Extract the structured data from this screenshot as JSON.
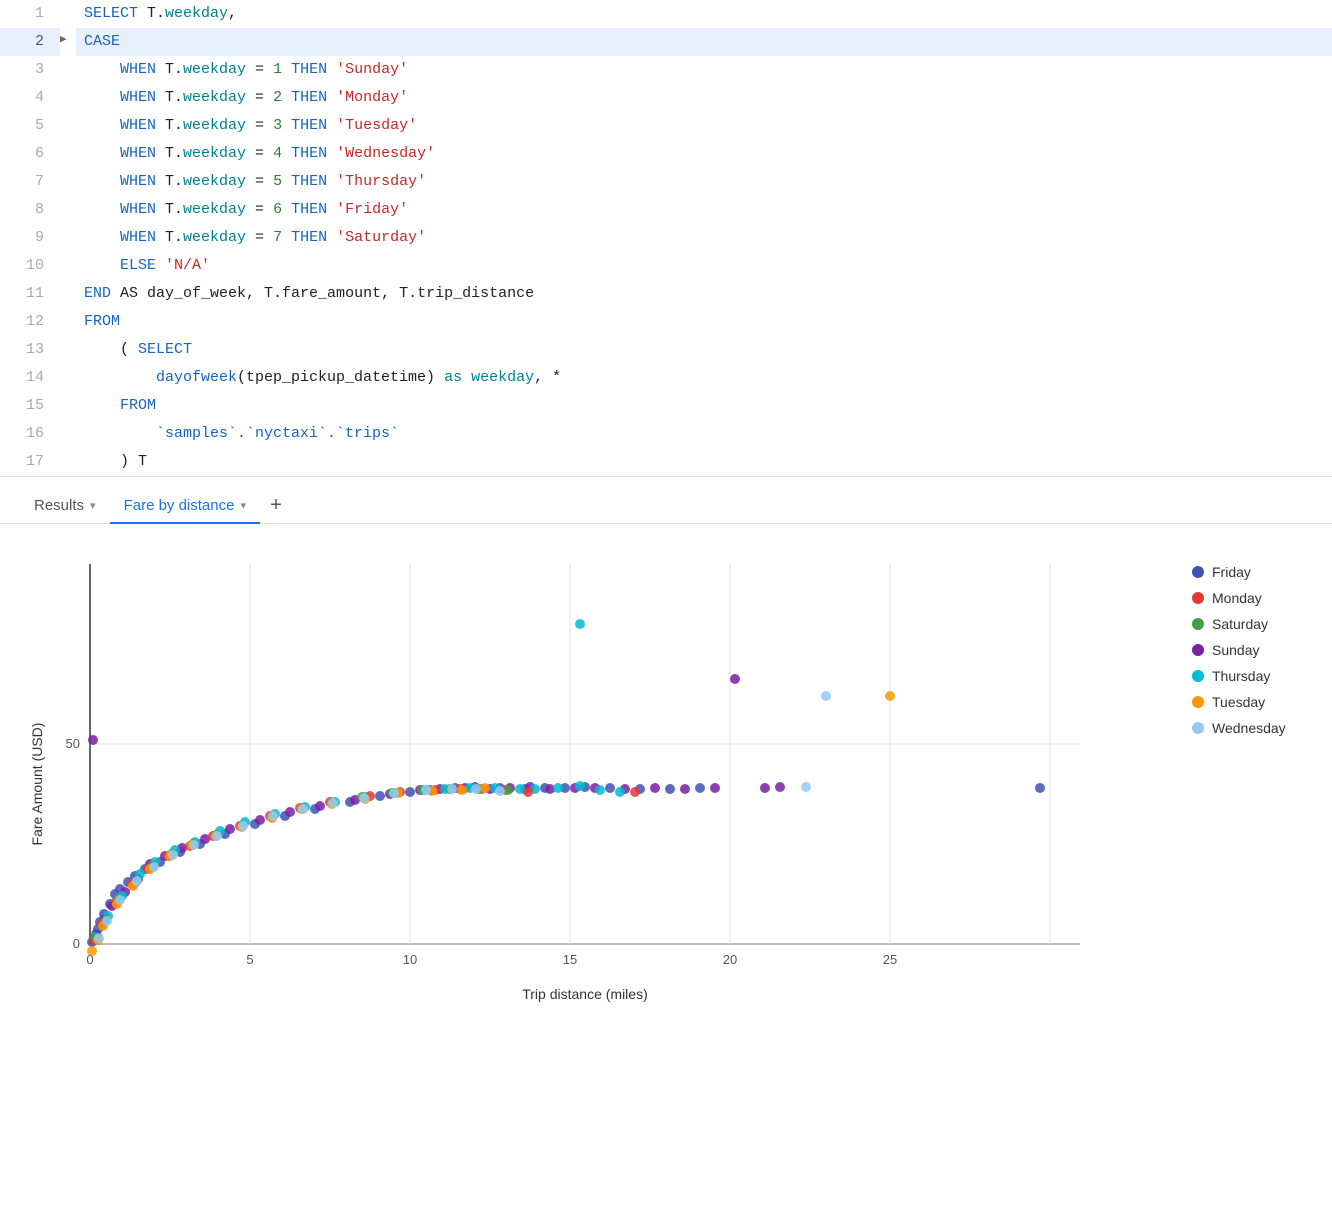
{
  "code": {
    "lines": [
      {
        "num": 1,
        "active": false,
        "content": [
          {
            "type": "kw-blue",
            "text": "SELECT "
          },
          {
            "type": "plain",
            "text": "T."
          },
          {
            "type": "kw-cyan",
            "text": "weekday"
          },
          {
            "type": "plain",
            "text": ","
          }
        ]
      },
      {
        "num": 2,
        "active": true,
        "content": [
          {
            "type": "kw-blue",
            "text": "CASE"
          }
        ]
      },
      {
        "num": 3,
        "active": false,
        "content": [
          {
            "type": "kw-blue",
            "text": "    WHEN "
          },
          {
            "type": "plain",
            "text": "T."
          },
          {
            "type": "kw-cyan",
            "text": "weekday"
          },
          {
            "type": "plain",
            "text": " = "
          },
          {
            "type": "num-green",
            "text": "1"
          },
          {
            "type": "kw-blue",
            "text": " THEN "
          },
          {
            "type": "str-red",
            "text": "'Sunday'"
          }
        ]
      },
      {
        "num": 4,
        "active": false,
        "content": [
          {
            "type": "kw-blue",
            "text": "    WHEN "
          },
          {
            "type": "plain",
            "text": "T."
          },
          {
            "type": "kw-cyan",
            "text": "weekday"
          },
          {
            "type": "plain",
            "text": " = "
          },
          {
            "type": "num-green",
            "text": "2"
          },
          {
            "type": "kw-blue",
            "text": " THEN "
          },
          {
            "type": "str-red",
            "text": "'Monday'"
          }
        ]
      },
      {
        "num": 5,
        "active": false,
        "content": [
          {
            "type": "kw-blue",
            "text": "    WHEN "
          },
          {
            "type": "plain",
            "text": "T."
          },
          {
            "type": "kw-cyan",
            "text": "weekday"
          },
          {
            "type": "plain",
            "text": " = "
          },
          {
            "type": "num-green",
            "text": "3"
          },
          {
            "type": "kw-blue",
            "text": " THEN "
          },
          {
            "type": "str-red",
            "text": "'Tuesday'"
          }
        ]
      },
      {
        "num": 6,
        "active": false,
        "content": [
          {
            "type": "kw-blue",
            "text": "    WHEN "
          },
          {
            "type": "plain",
            "text": "T."
          },
          {
            "type": "kw-cyan",
            "text": "weekday"
          },
          {
            "type": "plain",
            "text": " = "
          },
          {
            "type": "num-green",
            "text": "4"
          },
          {
            "type": "kw-blue",
            "text": " THEN "
          },
          {
            "type": "str-red",
            "text": "'Wednesday'"
          }
        ]
      },
      {
        "num": 7,
        "active": false,
        "content": [
          {
            "type": "kw-blue",
            "text": "    WHEN "
          },
          {
            "type": "plain",
            "text": "T."
          },
          {
            "type": "kw-cyan",
            "text": "weekday"
          },
          {
            "type": "plain",
            "text": " = "
          },
          {
            "type": "num-green",
            "text": "5"
          },
          {
            "type": "kw-blue",
            "text": " THEN "
          },
          {
            "type": "str-red",
            "text": "'Thursday'"
          }
        ]
      },
      {
        "num": 8,
        "active": false,
        "content": [
          {
            "type": "kw-blue",
            "text": "    WHEN "
          },
          {
            "type": "plain",
            "text": "T."
          },
          {
            "type": "kw-cyan",
            "text": "weekday"
          },
          {
            "type": "plain",
            "text": " = "
          },
          {
            "type": "num-green",
            "text": "6"
          },
          {
            "type": "kw-blue",
            "text": " THEN "
          },
          {
            "type": "str-red",
            "text": "'Friday'"
          }
        ]
      },
      {
        "num": 9,
        "active": false,
        "content": [
          {
            "type": "kw-blue",
            "text": "    WHEN "
          },
          {
            "type": "plain",
            "text": "T."
          },
          {
            "type": "kw-cyan",
            "text": "weekday"
          },
          {
            "type": "plain",
            "text": " = "
          },
          {
            "type": "num-green",
            "text": "7"
          },
          {
            "type": "kw-blue",
            "text": " THEN "
          },
          {
            "type": "str-red",
            "text": "'Saturday'"
          }
        ]
      },
      {
        "num": 10,
        "active": false,
        "content": [
          {
            "type": "kw-blue",
            "text": "    ELSE "
          },
          {
            "type": "str-red",
            "text": "'N/A'"
          }
        ]
      },
      {
        "num": 11,
        "active": false,
        "content": [
          {
            "type": "kw-blue",
            "text": "END "
          },
          {
            "type": "plain",
            "text": "AS "
          },
          {
            "type": "plain",
            "text": "day_of_week, T.fare_amount, T.trip_distance"
          }
        ]
      },
      {
        "num": 12,
        "active": false,
        "content": [
          {
            "type": "kw-blue",
            "text": "FROM"
          }
        ]
      },
      {
        "num": 13,
        "active": false,
        "content": [
          {
            "type": "plain",
            "text": "    ( "
          },
          {
            "type": "kw-blue",
            "text": "SELECT"
          }
        ]
      },
      {
        "num": 14,
        "active": false,
        "content": [
          {
            "type": "fn-blue",
            "text": "        dayofweek"
          },
          {
            "type": "plain",
            "text": "(tpep_pickup_datetime) "
          },
          {
            "type": "kw-cyan",
            "text": "as weekday"
          },
          {
            "type": "plain",
            "text": ", *"
          }
        ]
      },
      {
        "num": 15,
        "active": false,
        "content": [
          {
            "type": "kw-blue",
            "text": "    FROM"
          }
        ]
      },
      {
        "num": 16,
        "active": false,
        "content": [
          {
            "type": "backtick",
            "text": "        `samples`.`nyctaxi`.`trips`"
          }
        ]
      },
      {
        "num": 17,
        "active": false,
        "content": [
          {
            "type": "plain",
            "text": "    ) T"
          }
        ]
      }
    ]
  },
  "tabs": {
    "results_label": "Results",
    "fare_label": "Fare by distance",
    "add_label": "+"
  },
  "chart": {
    "x_label": "Trip distance (miles)",
    "y_label": "Fare Amount (USD)",
    "y_ticks": [
      "0",
      "50"
    ],
    "x_ticks": [
      "0",
      "5",
      "10",
      "15",
      "20",
      "25"
    ]
  },
  "legend": [
    {
      "label": "Friday",
      "color": "#3f51b5"
    },
    {
      "label": "Monday",
      "color": "#e53935"
    },
    {
      "label": "Saturday",
      "color": "#43a047"
    },
    {
      "label": "Sunday",
      "color": "#7b1fa2"
    },
    {
      "label": "Thursday",
      "color": "#00bcd4"
    },
    {
      "label": "Tuesday",
      "color": "#ff9800"
    },
    {
      "label": "Wednesday",
      "color": "#90caf9"
    }
  ]
}
